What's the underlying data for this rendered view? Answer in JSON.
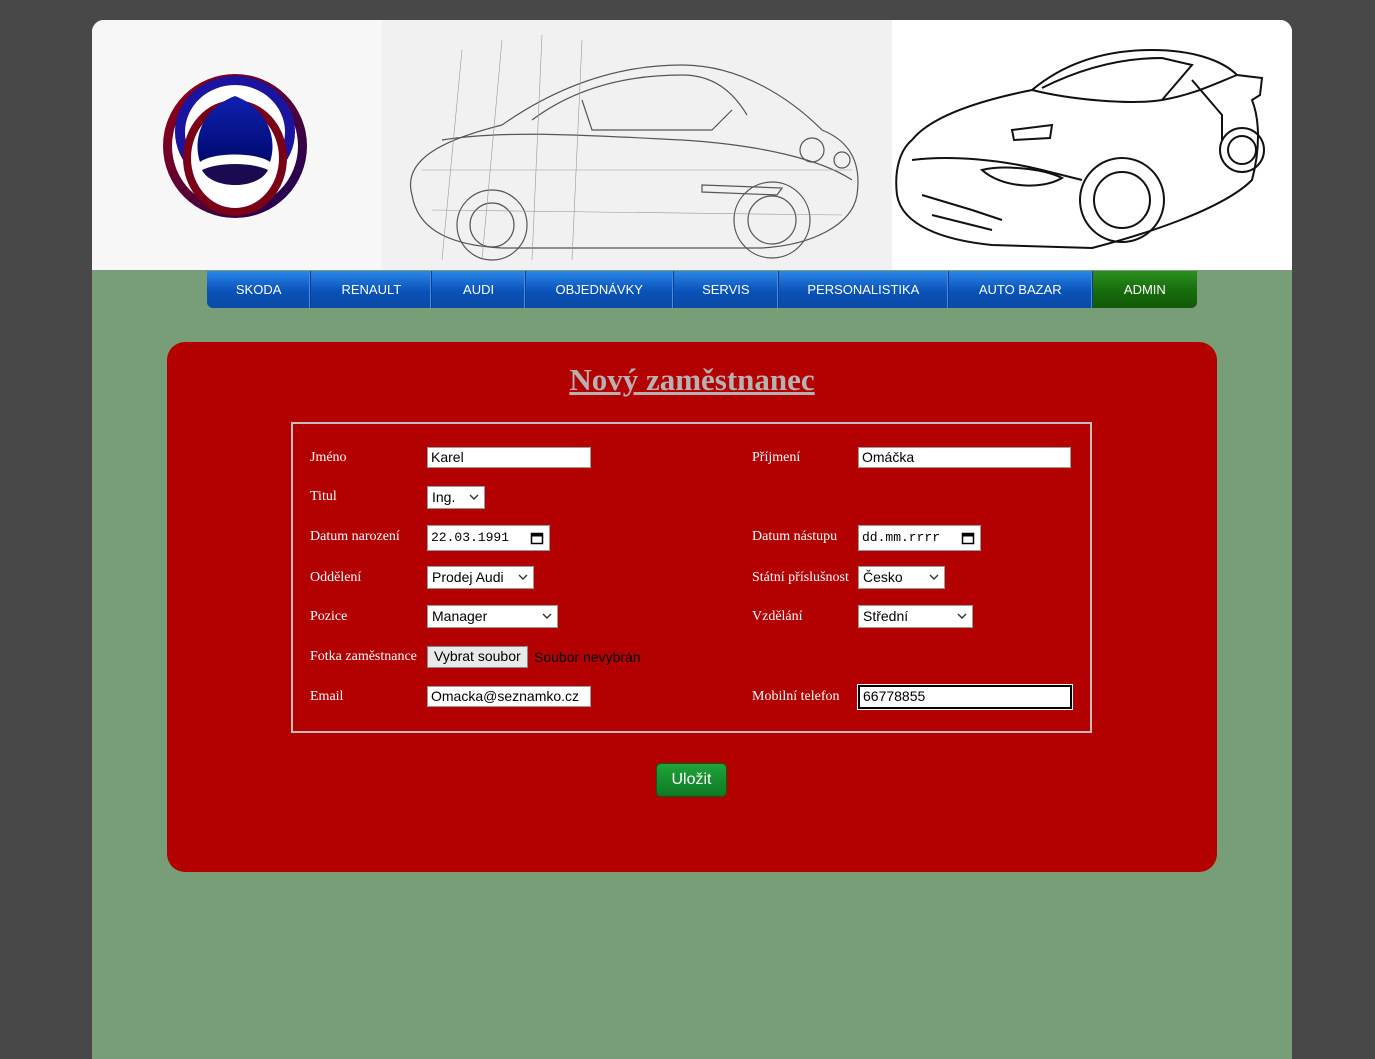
{
  "nav": {
    "items": [
      "SKODA",
      "RENAULT",
      "AUDI",
      "OBJEDNÁVKY",
      "SERVIS",
      "PERSONALISTIKA",
      "AUTO BAZAR",
      "ADMIN"
    ],
    "active": "ADMIN"
  },
  "form": {
    "title": "Nový zaměstnanec",
    "jmeno_label": "Jméno",
    "jmeno_value": "Karel",
    "prijmeni_label": "Příjmení",
    "prijmeni_value": "Omáčka",
    "titul_label": "Titul",
    "titul_value": "Ing.",
    "datum_narozeni_label": "Datum narození",
    "datum_narozeni_value": "22.03.1991",
    "datum_nastupu_label": "Datum nástupu",
    "datum_nastupu_value": "dd.mm.rrrr",
    "oddeleni_label": "Oddělení",
    "oddeleni_value": "Prodej Audi",
    "statni_label": "Státní příslušnost",
    "statni_value": "Česko",
    "pozice_label": "Pozice",
    "pozice_value": "Manager",
    "vzdelani_label": "Vzdělání",
    "vzdelani_value": "Střední",
    "fotka_label": "Fotka zaměstnance",
    "fotka_button": "Vybrat soubor",
    "fotka_status": "Soubor nevybrán",
    "email_label": "Email",
    "email_value": "Omacka@seznamko.cz",
    "telefon_label": "Mobilní telefon",
    "telefon_value": "66778855",
    "save_label": "Uložit"
  },
  "colors": {
    "background": "#484848",
    "page": "#789e78",
    "card": "#b30000",
    "nav": "#0a52b8",
    "nav_active": "#176b0c",
    "save": "#138a2c"
  }
}
